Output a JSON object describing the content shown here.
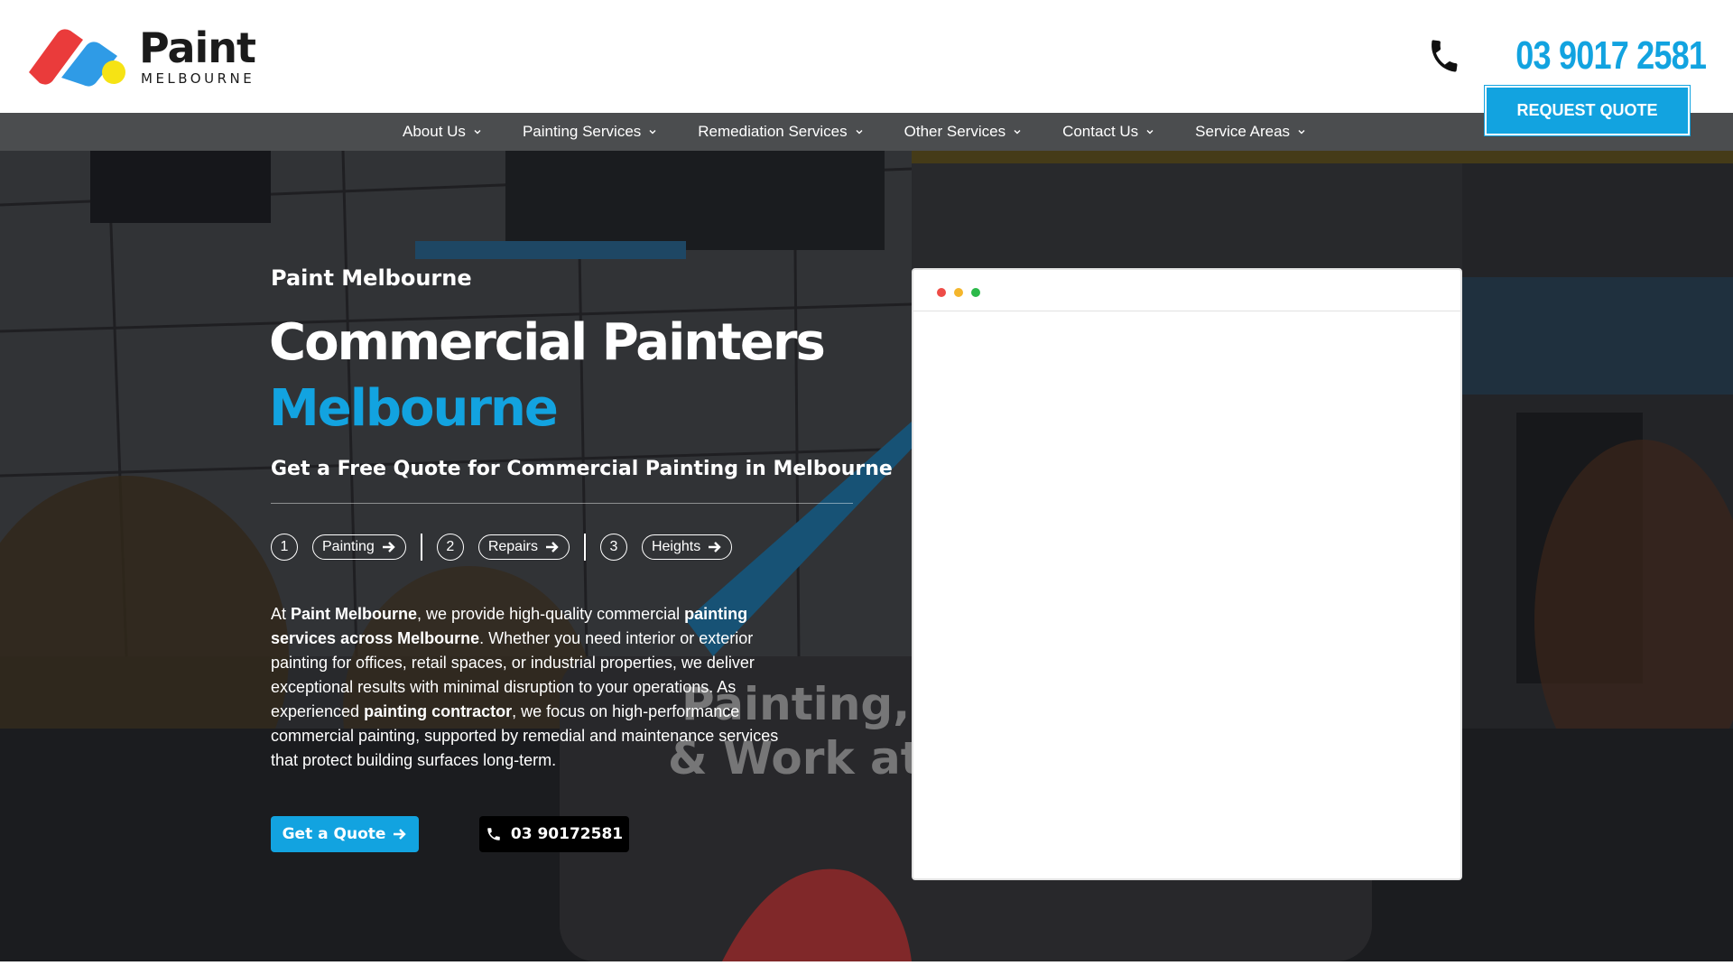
{
  "brand": {
    "name": "Paint",
    "subtitle": "MELBOURNE",
    "colors": {
      "primary": "#12a3e0",
      "red": "#ea3b3b",
      "yellow": "#f6e314",
      "blue": "#2f9be6",
      "nav_bg": "#4b4d4f"
    }
  },
  "header": {
    "phone": "03 9017 2581",
    "phone_icon": "phone-icon",
    "request_quote": "REQUEST QUOTE"
  },
  "nav": {
    "items": [
      {
        "label": "About Us"
      },
      {
        "label": "Painting Services"
      },
      {
        "label": "Remediation Services"
      },
      {
        "label": "Other Services"
      },
      {
        "label": "Contact Us"
      },
      {
        "label": "Service Areas"
      }
    ]
  },
  "hero": {
    "eyebrow": "Paint Melbourne",
    "title_line1": "Commercial Painters",
    "title_line2": "Melbourne",
    "subtitle": "Get a Free Quote for Commercial Painting in Melbourne",
    "steps": [
      {
        "num": "1",
        "label": "Painting"
      },
      {
        "num": "2",
        "label": "Repairs"
      },
      {
        "num": "3",
        "label": "Heights"
      }
    ],
    "body": {
      "p1": "At ",
      "b1": "Paint Melbourne",
      "p2": ", we provide high-quality commercial ",
      "b2": "painting services across Melbourne",
      "p3": ". Whether you need interior or exterior painting for offices, retail spaces, or industrial properties, we deliver exceptional results with minimal disruption to your operations. As experienced ",
      "b3": "painting contractor",
      "p4": ", we focus on high-performance commercial painting, supported by remedial and maintenance services that protect building surfaces long-term."
    },
    "cta_quote": "Get a Quote",
    "cta_phone": "03 90172581",
    "background_text_1": "Painting, R",
    "background_text_2": "& Work at Heights"
  }
}
